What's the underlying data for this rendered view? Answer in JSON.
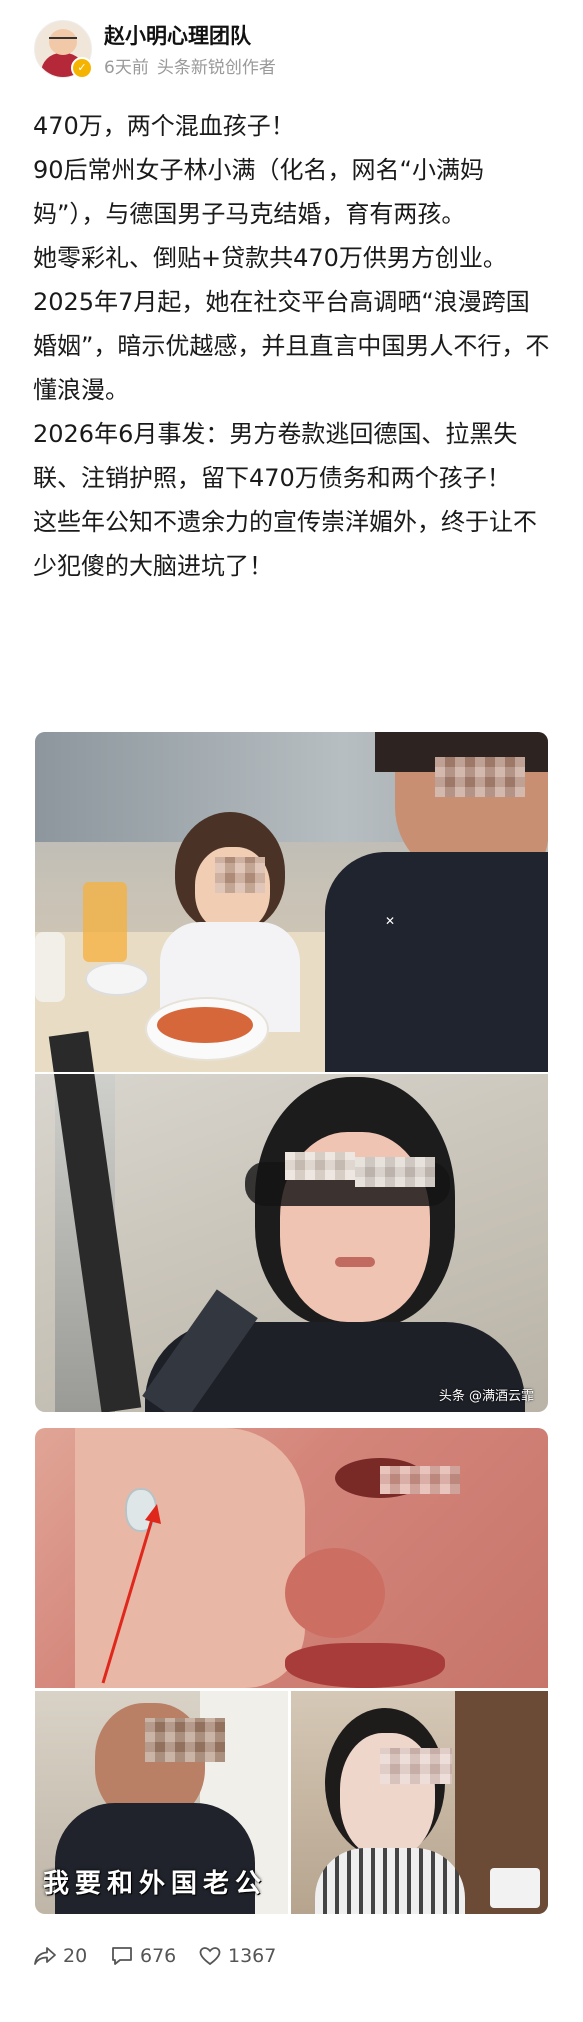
{
  "author": {
    "name": "赵小明心理团队",
    "time": "6天前",
    "tag": "头条新锐创作者"
  },
  "post": {
    "paragraphs": [
      "470万，两个混血孩子！",
      "90后常州女子林小满（化名，网名“小满妈妈”），与德国男子马克结婚，育有两孩。",
      "她零彩礼、倒贴+贷款共470万供男方创业。",
      "2025年7月起，她在社交平台高调晒“浪漫跨国婚姻”，暗示优越感，并且直言中国男人不行，不懂浪漫。",
      "2026年6月事发：男方卷款逃回德国、拉黑失联、注销护照，留下470万债务和两个孩子！",
      "这些年公知不遗余力的宣传崇洋媚外，终于让不少犯傻的大脑进坑了！"
    ]
  },
  "images": {
    "watermark": "头条 @满酒云霏",
    "subtitle": "我要和外国老公"
  },
  "stats": {
    "shares": "20",
    "comments": "676",
    "likes": "1367"
  },
  "colors": {
    "accent": "#f5b400",
    "text": "#1a1a1a",
    "muted": "#9a9a9a"
  }
}
